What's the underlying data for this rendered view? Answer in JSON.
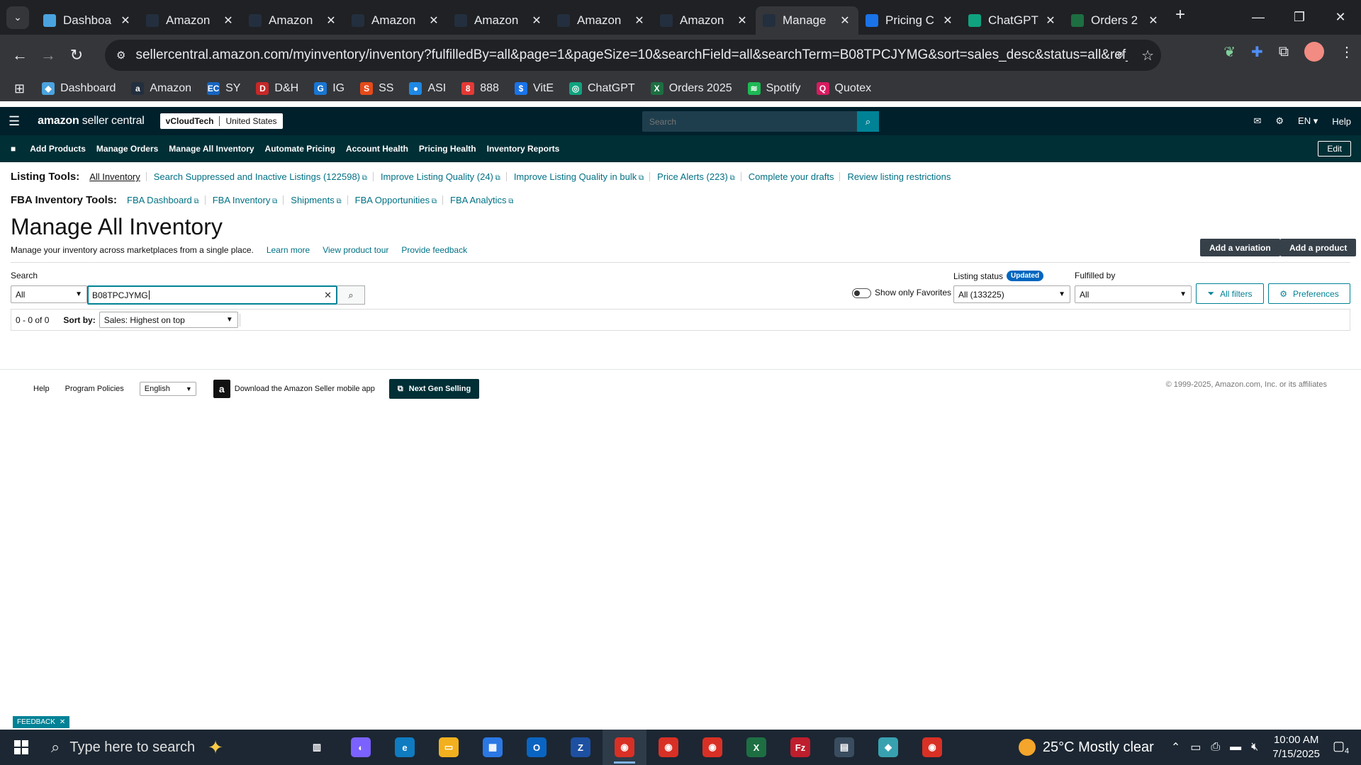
{
  "browser": {
    "tabs": [
      {
        "title": "Dashboa",
        "icon": "dashboard-icon",
        "color": "#4aa3df"
      },
      {
        "title": "Amazon",
        "icon": "amazon-icon",
        "color": "#232f3e"
      },
      {
        "title": "Amazon",
        "icon": "amazon-icon",
        "color": "#232f3e"
      },
      {
        "title": "Amazon",
        "icon": "amazon-icon",
        "color": "#232f3e"
      },
      {
        "title": "Amazon",
        "icon": "amazon-icon",
        "color": "#232f3e"
      },
      {
        "title": "Amazon",
        "icon": "amazon-icon",
        "color": "#232f3e"
      },
      {
        "title": "Amazon",
        "icon": "amazon-icon",
        "color": "#232f3e"
      },
      {
        "title": "Manage",
        "icon": "amazon-icon",
        "color": "#232f3e",
        "active": true
      },
      {
        "title": "Pricing C",
        "icon": "dollar-icon",
        "color": "#1a73e8"
      },
      {
        "title": "ChatGPT",
        "icon": "chatgpt-icon",
        "color": "#10a37f"
      },
      {
        "title": "Orders 2",
        "icon": "excel-icon",
        "color": "#1d6f42"
      }
    ],
    "url": "sellercentral.amazon.com/myinventory/inventory?fulfilledBy=all&page=1&pageSize=10&searchField=all&searchTerm=B08TPCJYMG&sort=sales_desc&status=all&ref_=xx_inv...",
    "bookmarks": [
      {
        "label": "Dashboard",
        "icon": "dashboard-icon",
        "color": "#4aa3df",
        "glyph": "◆"
      },
      {
        "label": "Amazon",
        "icon": "amazon-icon",
        "color": "#232f3e",
        "glyph": "a"
      },
      {
        "label": "SY",
        "icon": "ec-icon",
        "color": "#1565c0",
        "glyph": "EC"
      },
      {
        "label": "D&H",
        "icon": "dh-icon",
        "color": "#c62828",
        "glyph": "D"
      },
      {
        "label": "IG",
        "icon": "ig-icon",
        "color": "#1976d2",
        "glyph": "G"
      },
      {
        "label": "SS",
        "icon": "ss-icon",
        "color": "#e64a19",
        "glyph": "S"
      },
      {
        "label": "ASI",
        "icon": "asi-icon",
        "color": "#1e88e5",
        "glyph": "●"
      },
      {
        "label": "888",
        "icon": "888-icon",
        "color": "#e53935",
        "glyph": "8"
      },
      {
        "label": "VitE",
        "icon": "dollar-icon",
        "color": "#1a73e8",
        "glyph": "$"
      },
      {
        "label": "ChatGPT",
        "icon": "chatgpt-icon",
        "color": "#10a37f",
        "glyph": "◎"
      },
      {
        "label": "Orders 2025",
        "icon": "excel-icon",
        "color": "#1d6f42",
        "glyph": "X"
      },
      {
        "label": "Spotify",
        "icon": "spotify-icon",
        "color": "#1db954",
        "glyph": "≋"
      },
      {
        "label": "Quotex",
        "icon": "quotex-icon",
        "color": "#d81b60",
        "glyph": "Q"
      }
    ]
  },
  "sc": {
    "logo_bold": "amazon",
    "logo_rest": " seller central",
    "store": "vCloudTech",
    "country": "United States",
    "search_placeholder": "Search",
    "lang": "EN",
    "help": "Help",
    "nav": [
      "Add Products",
      "Manage Orders",
      "Manage All Inventory",
      "Automate Pricing",
      "Account Health",
      "Pricing Health",
      "Inventory Reports"
    ],
    "edit": "Edit"
  },
  "page": {
    "listing_tools_label": "Listing Tools:",
    "listing_tools": [
      {
        "label": "All Inventory",
        "current": true,
        "ext": false
      },
      {
        "label": "Search Suppressed and Inactive Listings (122598)",
        "ext": true
      },
      {
        "label": "Improve Listing Quality (24)",
        "ext": true
      },
      {
        "label": "Improve Listing Quality in bulk",
        "ext": true
      },
      {
        "label": "Price Alerts (223)",
        "ext": true
      },
      {
        "label": "Complete your drafts",
        "ext": false
      },
      {
        "label": "Review listing restrictions",
        "ext": false
      }
    ],
    "fba_tools_label": "FBA Inventory Tools:",
    "fba_tools": [
      {
        "label": "FBA Dashboard",
        "ext": true
      },
      {
        "label": "FBA Inventory",
        "ext": true
      },
      {
        "label": "Shipments",
        "ext": true
      },
      {
        "label": "FBA Opportunities",
        "ext": true
      },
      {
        "label": "FBA Analytics",
        "ext": true
      }
    ],
    "title": "Manage All Inventory",
    "subtitle": "Manage your inventory across marketplaces from a single place.",
    "learn_more": "Learn more",
    "product_tour": "View product tour",
    "feedback": "Provide feedback",
    "add_variation": "Add a variation",
    "add_product": "Add a product",
    "search_label": "Search",
    "search_field": "All",
    "search_value": "B08TPCJYMG",
    "favorites_label": "Show only Favorites",
    "listing_status_label": "Listing status",
    "updated_badge": "Updated",
    "listing_status_value": "All (133225)",
    "fulfilled_label": "Fulfilled by",
    "fulfilled_value": "All",
    "all_filters": "All filters",
    "preferences": "Preferences",
    "result_count": "0 - 0 of 0",
    "sort_label": "Sort by:",
    "sort_value": "Sales: Highest on top"
  },
  "footer": {
    "help": "Help",
    "policies": "Program Policies",
    "language": "English",
    "app": "Download the Amazon Seller mobile app",
    "next_gen": "Next Gen Selling",
    "copyright": "© 1999-2025, Amazon.com, Inc. or its affiliates",
    "feedback_tab": "FEEDBACK"
  },
  "taskbar": {
    "search_placeholder": "Type here to search",
    "weather": "25°C  Mostly clear",
    "time": "10:00 AM",
    "date": "7/15/2025",
    "notifications": "4",
    "apps": [
      {
        "name": "task-view-icon",
        "color": "#1c2733",
        "glyph": "▥"
      },
      {
        "name": "copilot-icon",
        "color": "#7b61ff",
        "glyph": "◐"
      },
      {
        "name": "edge-icon",
        "color": "#0f7bc0",
        "glyph": "e"
      },
      {
        "name": "file-explorer-icon",
        "color": "#f2b01e",
        "glyph": "▭"
      },
      {
        "name": "store-icon",
        "color": "#2b78e4",
        "glyph": "▦"
      },
      {
        "name": "outlook-icon",
        "color": "#0a64c2",
        "glyph": "O"
      },
      {
        "name": "zoho-icon",
        "color": "#1e50a2",
        "glyph": "Z"
      },
      {
        "name": "chrome-icon",
        "color": "#d93025",
        "glyph": "◉",
        "active": true
      },
      {
        "name": "chrome-icon",
        "color": "#d93025",
        "glyph": "◉"
      },
      {
        "name": "chrome-icon",
        "color": "#d93025",
        "glyph": "◉"
      },
      {
        "name": "excel-icon",
        "color": "#1d6f42",
        "glyph": "X"
      },
      {
        "name": "filezilla-icon",
        "color": "#bf1e2d",
        "glyph": "Fz"
      },
      {
        "name": "calculator-icon",
        "color": "#3a4d60",
        "glyph": "▤"
      },
      {
        "name": "app-icon",
        "color": "#38a1b0",
        "glyph": "◆"
      },
      {
        "name": "chrome-icon",
        "color": "#d93025",
        "glyph": "◉"
      }
    ]
  }
}
